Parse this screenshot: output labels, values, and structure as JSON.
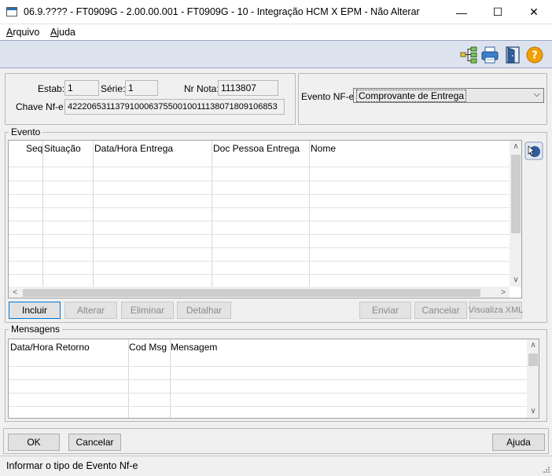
{
  "window": {
    "title": "06.9.???? - FT0909G - 2.00.00.001 - FT0909G - 10 - Integração HCM X EPM - Não Alterar",
    "minimize": "—",
    "maximize": "☐",
    "close": "✕"
  },
  "menu": {
    "arquivo_u": "A",
    "arquivo_rest": "rquivo",
    "ajuda_u": "A",
    "ajuda_rest": "juda"
  },
  "toolbar": {
    "icons": [
      "tree-structure-icon",
      "printer-icon",
      "exit-door-icon",
      "help-icon"
    ],
    "help_glyph": "?"
  },
  "header": {
    "estab_label": "Estab:",
    "estab_value": "1",
    "serie_label": "Série:",
    "serie_value": "1",
    "nrnota_label": "Nr Nota:",
    "nrnota_value": "1113807",
    "chave_label": "Chave Nf-e:",
    "chave_value": "42220653113791000637550010011138071809106853"
  },
  "evento_select": {
    "label": "Evento NF-e:",
    "value": "Comprovante de Entrega"
  },
  "evento_group": {
    "legend": "Evento",
    "columns": [
      "Seq",
      "Situação",
      "Data/Hora Entrega",
      "Doc Pessoa Entrega",
      "Nome"
    ],
    "buttons": {
      "incluir": "Incluir",
      "alterar": "Alterar",
      "eliminar": "Eliminar",
      "detalhar": "Detalhar",
      "enviar": "Enviar",
      "cancelar": "Cancelar",
      "visualiza": "Visualiza XML"
    }
  },
  "mensagens_group": {
    "legend": "Mensagens",
    "columns": [
      "Data/Hora Retorno",
      "Cod Msg",
      "Mensagem"
    ]
  },
  "footer": {
    "ok": "OK",
    "cancelar": "Cancelar",
    "ajuda": "Ajuda"
  },
  "status": {
    "text": "Informar o tipo de Evento Nf-e"
  },
  "colors": {
    "toolbar_bg": "#dde3ee",
    "default_button_border": "#0078d7",
    "help_icon": "#f0a000"
  }
}
